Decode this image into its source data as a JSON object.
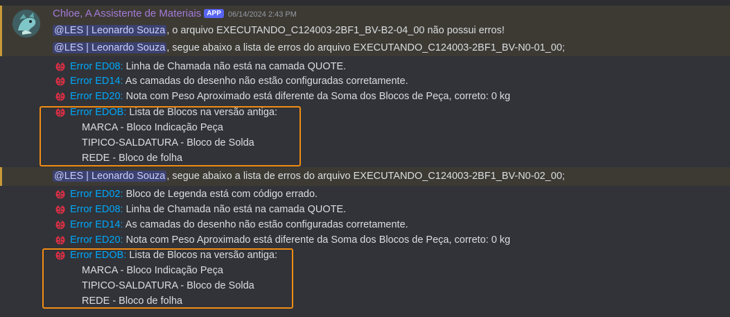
{
  "header": {
    "username": "Chloe, A Assistente de Materiais",
    "app_tag": "APP",
    "timestamp": "06/14/2024 2:43 PM"
  },
  "messages": [
    {
      "mention": "@LES | Leonardo Souza",
      "text": ", o arquivo EXECUTANDO_C124003-2BF1_BV-B2-04_00 não possui erros!"
    },
    {
      "mention": "@LES | Leonardo Souza",
      "text": ", segue abaixo a lista de erros do arquivo EXECUTANDO_C124003-2BF1_BV-N0-01_00;"
    },
    {
      "mention": "@LES | Leonardo Souza",
      "text": ", segue abaixo a lista de erros do arquivo EXECUTANDO_C124003-2BF1_BV-N0-02_00;"
    }
  ],
  "errors_group1": [
    {
      "code": "Error ED08:",
      "text": " Linha de Chamada não está na camada QUOTE."
    },
    {
      "code": "Error ED14:",
      "text": " As camadas do desenho não estão configuradas corretamente."
    },
    {
      "code": "Error ED20:",
      "text": " Nota com Peso Aproximado está diferente da Soma dos Blocos de Peça, correto: 0 kg"
    },
    {
      "code": "Error EDOB:",
      "text": " Lista de Blocos na versão antiga:"
    }
  ],
  "blocks_group1": [
    "MARCA - Bloco Indicação Peça",
    "TIPICO-SALDATURA - Bloco de Solda",
    "REDE - Bloco de folha"
  ],
  "errors_group2": [
    {
      "code": "Error ED02:",
      "text": " Bloco de Legenda está com código errado."
    },
    {
      "code": "Error ED08:",
      "text": " Linha de Chamada não está na camada QUOTE."
    },
    {
      "code": "Error ED14:",
      "text": " As camadas do desenho não estão configuradas corretamente."
    },
    {
      "code": "Error ED20:",
      "text": " Nota com Peso Aproximado está diferente da Soma dos Blocos de Peça, correto: 0 kg"
    },
    {
      "code": "Error EDOB:",
      "text": " Lista de Blocos na versão antiga:"
    }
  ],
  "blocks_group2": [
    "MARCA - Bloco Indicação Peça",
    "TIPICO-SALDATURA - Bloco de Solda",
    "REDE - Bloco de folha"
  ],
  "colors": {
    "background": "#313338",
    "highlight": "#3d3a34",
    "highlight_border": "#c99a3a",
    "username": "#a47bd9",
    "error_code": "#00a8fc",
    "annotation_box": "#f28c13"
  },
  "icons": {
    "avatar": "dragon-avatar-icon",
    "error": "ladybug-icon"
  }
}
